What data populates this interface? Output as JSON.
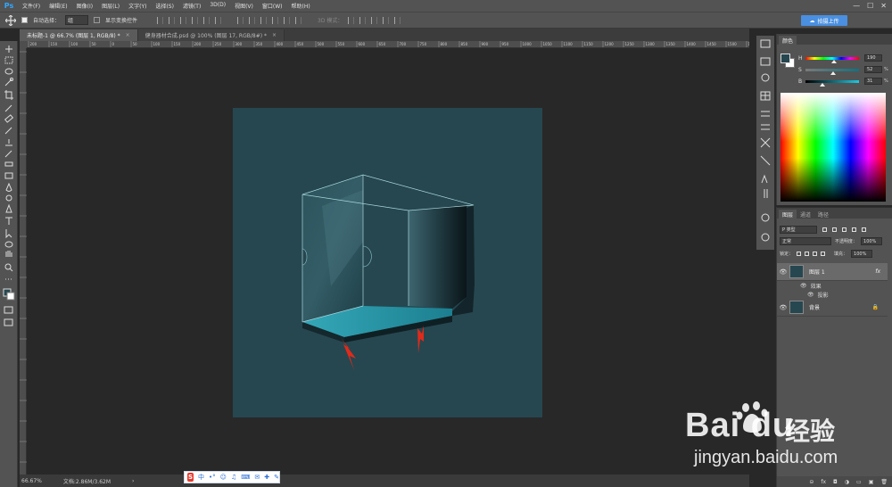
{
  "app": {
    "logo": "Ps"
  },
  "menu": {
    "items": [
      "文件(F)",
      "编辑(E)",
      "图像(I)",
      "图层(L)",
      "文字(Y)",
      "选择(S)",
      "滤镜(T)",
      "3D(D)",
      "视图(V)",
      "窗口(W)",
      "帮助(H)"
    ]
  },
  "window_controls": {
    "minimize": "—",
    "maximize": "☐",
    "close": "✕"
  },
  "options": {
    "auto_select_label": "自动选择：",
    "auto_select_value": "组",
    "show_transform_label": "显示变换控件",
    "mode_3d_label": "3D 模式：",
    "share_button": "拍摄上传"
  },
  "tabs": [
    {
      "label": "未标题-1 @ 66.7% (图层 1, RGB/8) *",
      "close": "×"
    },
    {
      "label": "健身器材合成.psd @ 100% (图层 17, RGB/8#) *",
      "close": "×"
    }
  ],
  "ruler": {
    "ticks": [
      "200",
      "150",
      "100",
      "50",
      "0",
      "50",
      "100",
      "150",
      "200",
      "250",
      "300",
      "350",
      "400",
      "450",
      "500",
      "550",
      "600",
      "650",
      "700",
      "750",
      "800",
      "850",
      "900",
      "950",
      "1000",
      "1050",
      "1100",
      "1150",
      "1200",
      "1250",
      "1300",
      "1350",
      "1400",
      "1450",
      "1500",
      "1550"
    ]
  },
  "status": {
    "zoom": "66.67%",
    "doc_size": "文档:2.86M/3.62M",
    "arrow": "›"
  },
  "ime": {
    "logo": "S",
    "lang": "中",
    "punct": "•°",
    "items": [
      "☺",
      "♫",
      "⌨",
      "✉",
      "✚",
      "✎"
    ]
  },
  "color_panel": {
    "tab": "颜色",
    "sliders": [
      {
        "letter": "H",
        "value": "190",
        "unit": "",
        "pos": 0.53,
        "gradient": "linear-gradient(to right,#f00,#ff0,#0f0,#0ff,#00f,#f0f,#f00)"
      },
      {
        "letter": "S",
        "value": "52",
        "unit": "%",
        "pos": 0.52,
        "gradient": "linear-gradient(to right,#7a7a7a,#13727f)"
      },
      {
        "letter": "B",
        "value": "31",
        "unit": "%",
        "pos": 0.31,
        "gradient": "linear-gradient(to right,#000,#1ec8e0)"
      }
    ],
    "fg_color": "#264750",
    "bg_color": "#ffffff"
  },
  "layers_panel": {
    "tabs": [
      "图层",
      "通道",
      "路径"
    ],
    "filter_label": "P 类型",
    "blend_mode": "正常",
    "opacity_label": "不透明度：",
    "opacity_value": "100%",
    "lock_label": "锁定：",
    "fill_label": "填充：",
    "fill_value": "100%",
    "layers": [
      {
        "name": "图层 1",
        "fx": "fx",
        "selected": true
      },
      {
        "name": "背景",
        "lock": "🔒",
        "selected": false
      }
    ],
    "effects_label": "效果",
    "shadow_label": "投影",
    "footer": [
      "⊝",
      "fx",
      "◘",
      "◑",
      "▭",
      "▣",
      "🗑"
    ]
  },
  "watermark": {
    "brand": "Bai  du",
    "cn": "经验",
    "url": "jingyan.baidu.com"
  }
}
